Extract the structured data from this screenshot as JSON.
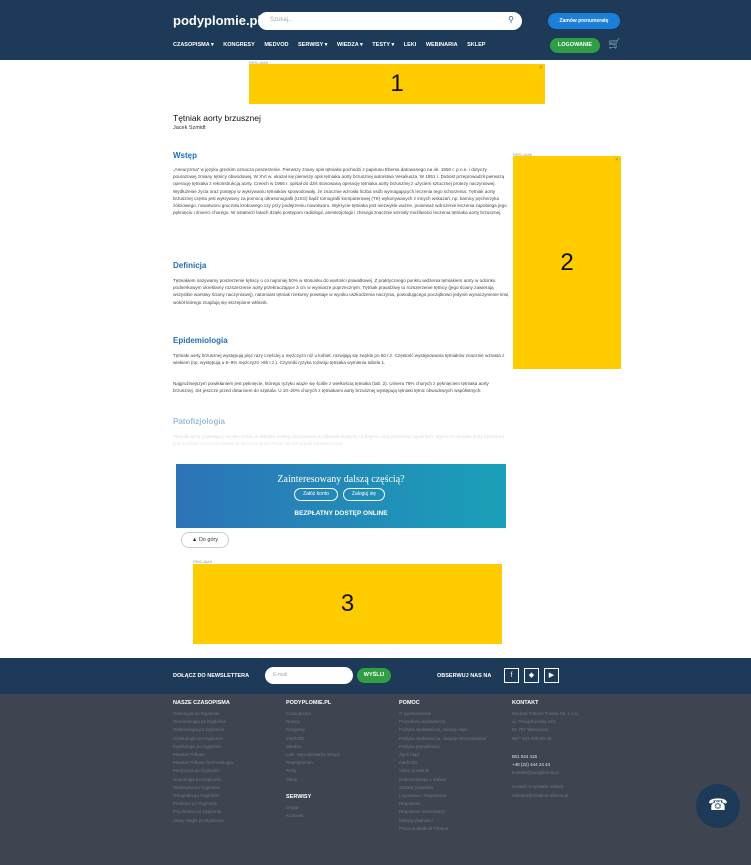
{
  "header": {
    "logo": "podyplomie.pl",
    "search_placeholder": "Szukaj...",
    "order_btn": "Zamów prenumeratę",
    "nav": [
      "CZASOPISMA ▾",
      "KONGRESY",
      "MEDVOD",
      "SERWISY ▾",
      "WIEDZA ▾",
      "TESTY ▾",
      "LEKI",
      "WEBINARIA",
      "SKLEP"
    ],
    "login_btn": "LOGOWANIE"
  },
  "ads": {
    "label": "REKLAMA",
    "a1": "1",
    "a2": "2",
    "a3": "3"
  },
  "article": {
    "title": "Tętniak aorty brzusznej",
    "author": "Jacek Szmidt",
    "sections": [
      {
        "heading": "Wstęp",
        "text": "„Aneuryzma” w języku greckim oznacza poszerzenie. Pierwszy znany opis tętniaka pochodzi z papirusu Ebersa datowanego na ok. 1550 r. p.n.e. i dotyczy pourazowej zmiany tętnicy obwodowej. W XVI w. ukazał się pierwszy opis tętniaka aorty brzusznej autorstwa Vesaliusza. W 1951 r. Dubost przeprowadził pierwszą operację tętniaka z rekonstrukcją aorty. Creech w 1966 r. opisał do dziś stosowaną operację tętniaka aorty brzusznej z użyciem sztucznej protezy naczyniowej. Wydłużenie życia oraz postępy w wykrywaniu tętniaków spowodowały, że znacznie wzrosła liczba osób wymagających leczenia tego schorzenia. Tętniak aorty brzusznej często jest wykrywany za pomocą ultrasonografii (USG) bądź tomografii komputerowej (TK) wykonywanych z innych wskazań, np. kamicy pęcherzyka żółciowego, nowotworu gruczołu krokowego czy przy podejrzeniu nowotworu. Wykrycie tętniaka jest niezwykle ważne, ponieważ wdrożenie leczenia zapobiega jego pęknięciu i śmierci chorego. W ostatnich latach dzięki postępom radiologii, anestezjologii i chirurgii znacznie wzrosły możliwości leczenia tętniaka aorty brzusznej."
      },
      {
        "heading": "Definicja",
        "text": "Tętniakiem nazywamy poszerzenie tętnicy o co najmniej 50% w stosunku do wartości prawidłowej. Z praktycznego punktu widzenia tętniakiem aorty w odcinku podnerkowym określamy rozszerzenie aorty przekraczające 3 cm w wymiarze poprzecznym. Tętniak prawdziwy to rozszerzenie tętnicy (jego ściany zawierają wszystkie warstwy ściany naczyniowej), natomiast tętniak rzekomy powstaje w wyniku uszkodzenia naczynia, powodującego początkowo jedynie wynaczynienie krwi, wokół którego znajdują się skrzepione włóknik."
      },
      {
        "heading": "Epidemiologia",
        "text": "Tętniaki aorty brzusznej występują pięć razy częściej u mężczyzn niż u kobiet, rozwijają się zwykle po 50 r.ż. Częstość występowania tętniaków znacznie wzrasta z wiekiem (np. występują u 6–9% mężczyzn >65 r.ż.). Czynniki ryzyka rozwoju tętniaka wymienia tabela 1."
      },
      {
        "heading": "",
        "text": "Najgroźniejszym powikłaniem jest pęknięcie, którego ryzyko wiąże się ściśle z wielkością tętniaka (tab. 2). Umiera 78% chorych z pęknięciem tętniaka aorty brzusznej. 3/4 jeszcze przed dotarciem do szpitala. U 10–20% chorych z tętniakami aorty brzusznej występują tętniaki tętnic obwodowych współistnych."
      },
      {
        "heading": "Patofizjologia",
        "text": "Tętniaki aorty powstają w wyniku zmian w składzie ściany naczyniowej w zakresie elastyny i kolagenu oraz procesów zapalnych. Wykrycie tętniaka aorty brzusznej jest możliwe za pomocą badania ultrasonograficznego lub tomografii komputerowej."
      }
    ]
  },
  "paywall": {
    "title": "Zainteresowany dalszą częścią?",
    "register": "Załóż konto",
    "login": "Zaloguj się",
    "free": "BEZPŁATNY DOSTĘP ONLINE"
  },
  "up_btn": "Do góry",
  "newsletter": {
    "label": "DOŁĄCZ DO NEWSLETTERA",
    "placeholder": "E-mail",
    "send": "WYŚLIJ",
    "follow": "OBSERWUJ NAS NA"
  },
  "footer": {
    "col1": {
      "title": "NASZE CZASOPISMA",
      "items": [
        "Onkologia po Dyplomie",
        "Dermatologia po Dyplomie",
        "Diabetologia po Dyplomie",
        "Ginekologia po Dyplomie",
        "Kardiologia po Dyplomie",
        "Medical Tribune",
        "Medical Tribune Dermatologia",
        "Medycyna po Dyplomie",
        "Neurologia po Dyplomie",
        "Okulistyka po Dyplomie",
        "Ortopedia po Dyplomie",
        "Pediatria po Dyplomie",
        "Psychiatria po Dyplomie",
        "Stany Nagłe po Dyplomie"
      ]
    },
    "col2": {
      "title": "PODYPLOMIE.PL",
      "items": [
        "Czasopisma",
        "Nowny",
        "Kongresy",
        "medVOD",
        "Wiedza",
        "Leki: Wyszukiwarka Terapii",
        "Repetytorium",
        "Testy",
        "Sklep"
      ],
      "title2": "SERWISY",
      "items2": [
        "Grypa",
        "Krztusiec"
      ]
    },
    "col3": {
      "title": "POMOC",
      "items": [
        "O wydawnictwie",
        "Procedura wydawnicza",
        "Polityka wydawnicza, zasady etyki",
        "Polityka wydawnicza, zasady recenzowania",
        "Polityka prywatności",
        "Zgoś błąd",
        "medVOD",
        "Video poradnik",
        "Dokumentacja o reklam",
        "Zasady prawnika",
        "Logowanie i Rejestracja",
        "Regulamin",
        "Regulamin komentarzy",
        "Metody płatności",
        "Praca w Medical Tribune"
      ]
    },
    "col4": {
      "title": "KONTAKT",
      "items": [
        "Medical Tribune Polska Sp. z o.o.",
        "ul. Powązkowska 44C",
        "01-797 Warszawa",
        "NIP: 521-008-60-45"
      ],
      "phone1": "801 044 415",
      "phone2": "+48 (22) 444 24 44",
      "email": "kontakt@podyplomie.pl",
      "items2": [
        "Kontakt w sprawie reklam",
        "reklama@medical-tribune.pl"
      ]
    }
  },
  "colors": {
    "header": "#1d3a59",
    "accent": "#1e6fb5",
    "ad": "#ffcc00",
    "green": "#2f9e44"
  }
}
